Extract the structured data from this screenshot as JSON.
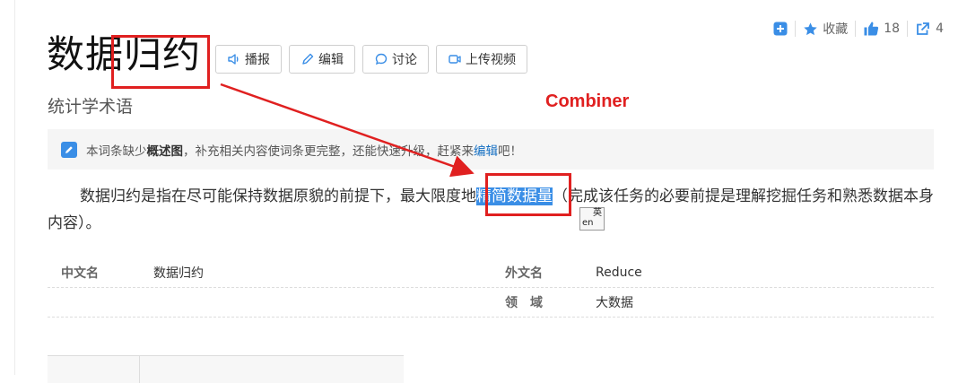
{
  "toolbar": {
    "collect_label": "收藏",
    "like_count": "18",
    "share_count": "4"
  },
  "title": {
    "part1": "数据",
    "part2": "归约",
    "subtitle": "统计学术语"
  },
  "actions": {
    "broadcast": "播报",
    "edit": "编辑",
    "discuss": "讨论",
    "upload_video": "上传视频"
  },
  "annotation": {
    "label": "Combiner"
  },
  "notice": {
    "part1": "本词条缺少",
    "bold": "概述图",
    "part2": "，补充相关内容使词条更完整，还能快速升级，赶紧来",
    "link": "编辑",
    "part3": "吧！"
  },
  "paragraph": {
    "part1": "数据归约是指在尽可能保持数据原貌的前提下，最大限度地",
    "highlight": "精简数据量",
    "part2": "（完成该任务的必要前提是理解挖掘任务和熟悉数据本身内容）。"
  },
  "translate_icon": {
    "top": "英",
    "bottom": "en"
  },
  "info": {
    "rows": [
      {
        "k1": "中文名",
        "v1": "数据归约",
        "k2": "外文名",
        "v2": "Reduce"
      },
      {
        "k1": "",
        "v1": "",
        "k2": "领　域",
        "v2": "大数据"
      }
    ]
  },
  "colors": {
    "accent": "#3a8ee6",
    "annotation_red": "#e02020",
    "link": "#136ec2"
  }
}
